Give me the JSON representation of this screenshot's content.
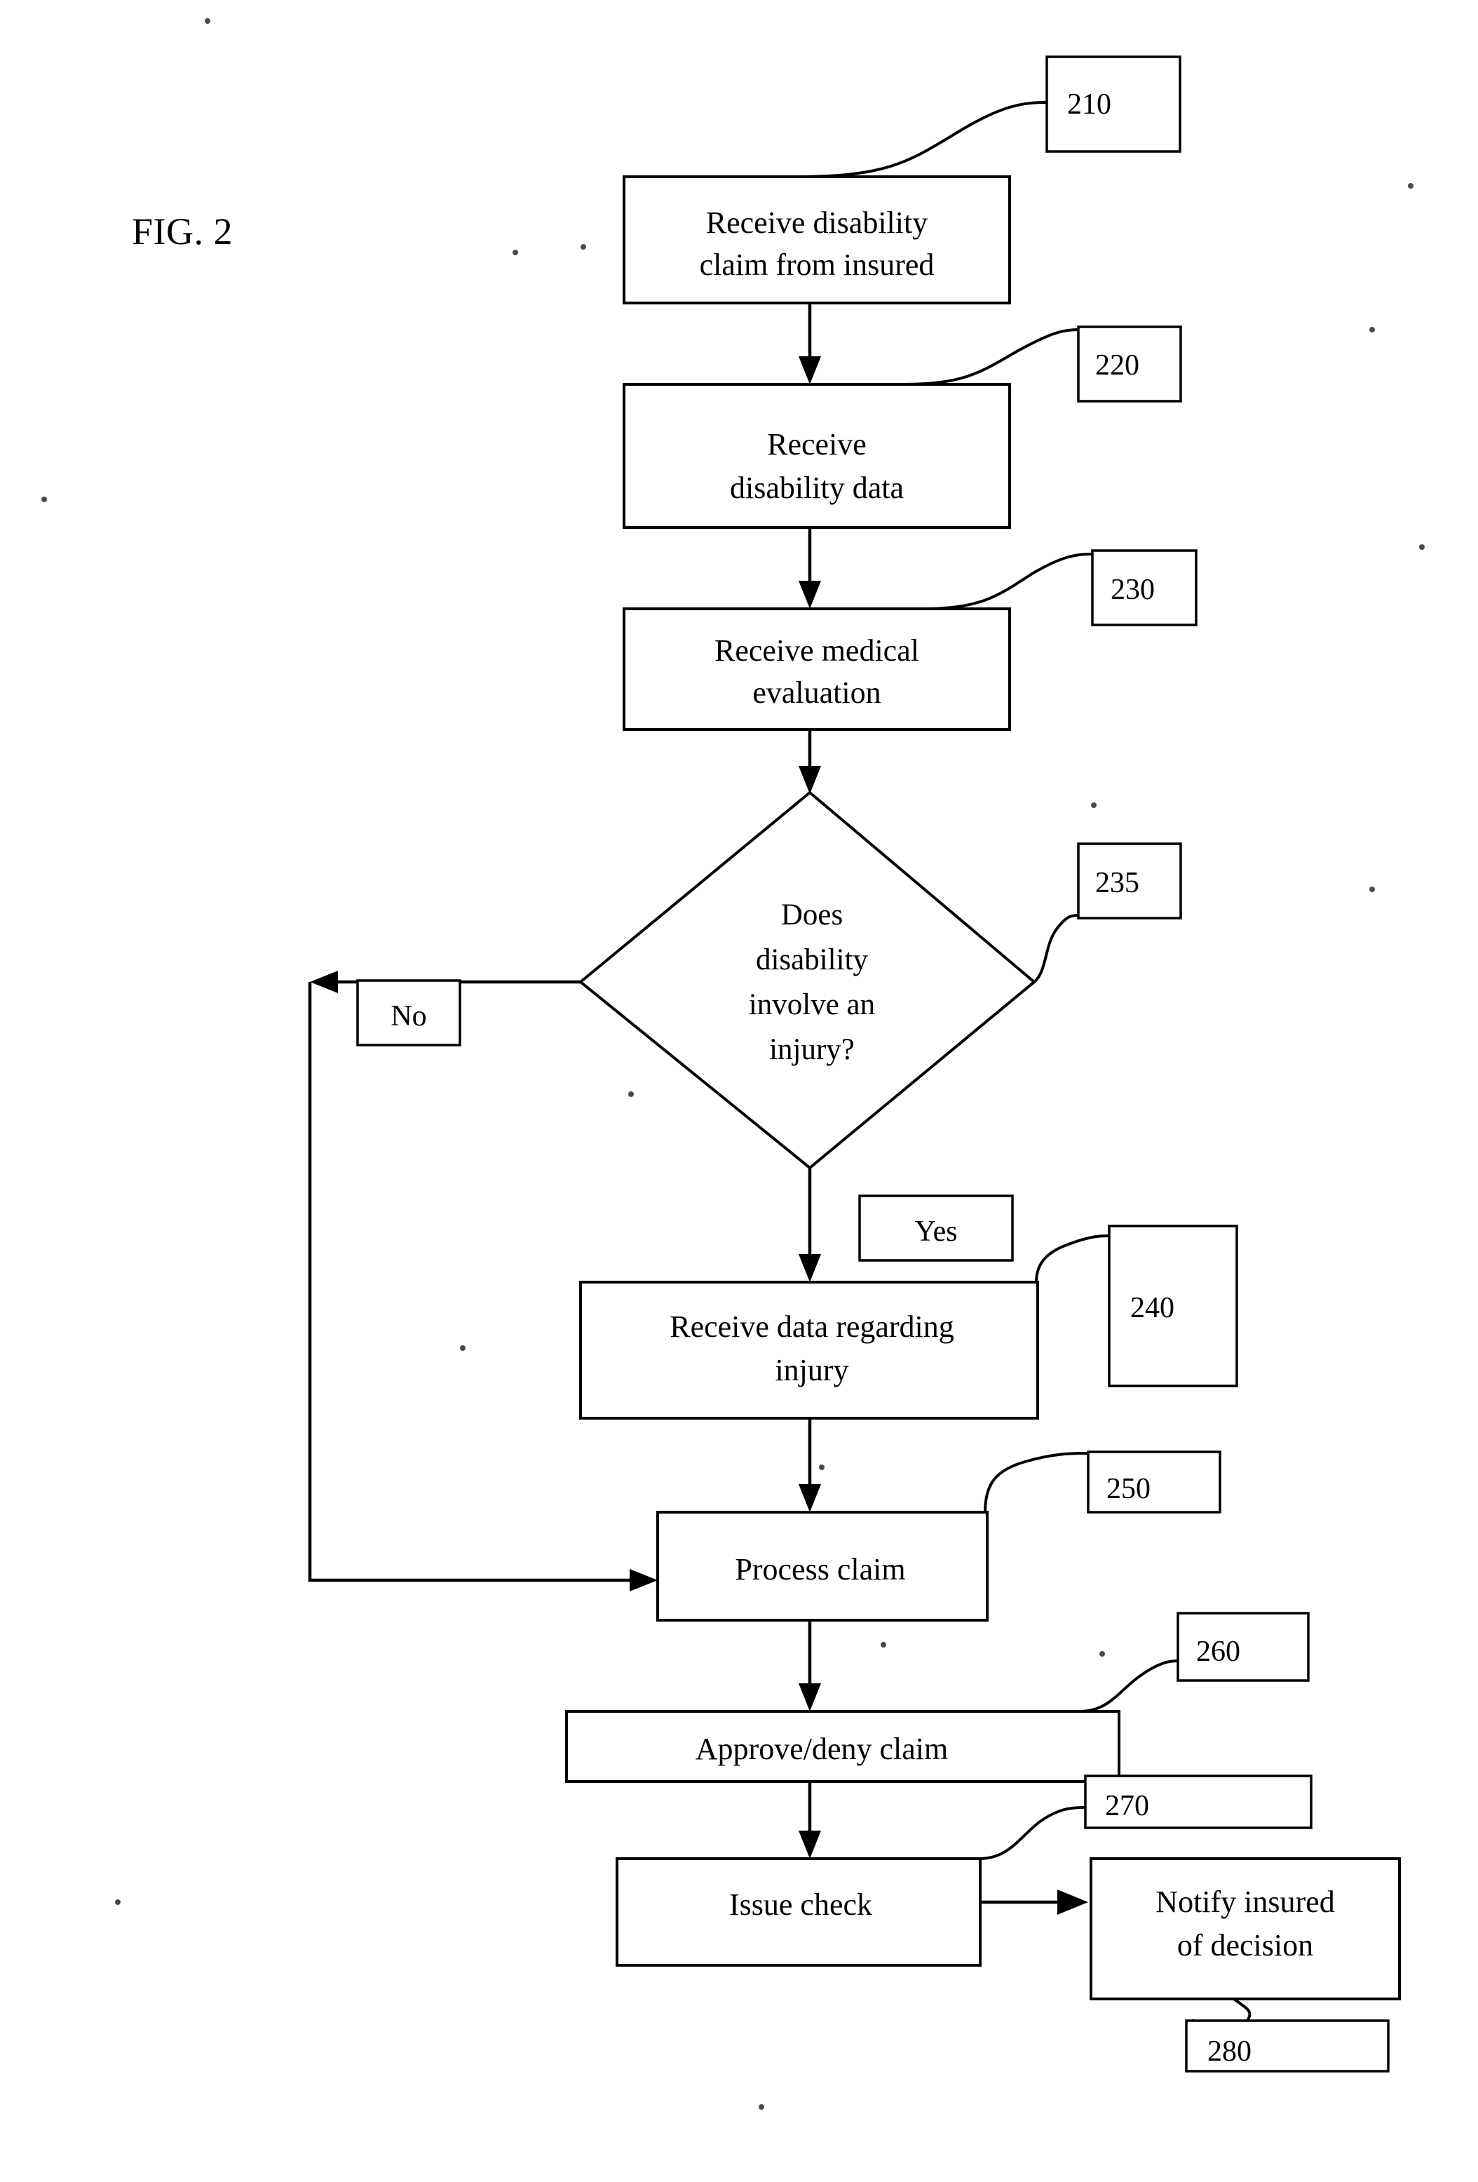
{
  "figure": {
    "title": "FIG. 2"
  },
  "nodes": [
    {
      "id": "node-210",
      "ref": "210",
      "lines": [
        "Receive disability",
        "claim from insured"
      ],
      "shape": "rect"
    },
    {
      "id": "node-220",
      "ref": "220",
      "lines": [
        "Receive",
        "disability data"
      ],
      "shape": "rect"
    },
    {
      "id": "node-230",
      "ref": "230",
      "lines": [
        "Receive medical",
        "evaluation"
      ],
      "shape": "rect"
    },
    {
      "id": "node-235",
      "ref": "235",
      "lines": [
        "Does",
        "disability",
        "involve an",
        "injury?"
      ],
      "shape": "diamond"
    },
    {
      "id": "node-240",
      "ref": "240",
      "lines": [
        "Receive data regarding",
        "injury"
      ],
      "shape": "rect"
    },
    {
      "id": "node-250",
      "ref": "250",
      "lines": [
        "Process claim"
      ],
      "shape": "rect"
    },
    {
      "id": "node-260",
      "ref": "260",
      "lines": [
        "Approve/deny claim"
      ],
      "shape": "rect"
    },
    {
      "id": "node-270",
      "ref": "270",
      "lines": [
        "Issue check"
      ],
      "shape": "rect"
    },
    {
      "id": "node-280",
      "ref": "280",
      "lines": [
        "Notify insured",
        "of decision"
      ],
      "shape": "rect"
    }
  ],
  "branches": {
    "no_label": "No",
    "yes_label": "Yes"
  },
  "refs": {
    "r210": "210",
    "r220": "220",
    "r230": "230",
    "r235": "235",
    "r240": "240",
    "r250": "250",
    "r260": "260",
    "r270": "270",
    "r280": "280"
  },
  "text": {
    "t210_l1": "Receive disability",
    "t210_l2": "claim from insured",
    "t220_l1": "Receive",
    "t220_l2": "disability data",
    "t230_l1": "Receive medical",
    "t230_l2": "evaluation",
    "t235_l1": "Does",
    "t235_l2": "disability",
    "t235_l3": "involve an",
    "t235_l4": "injury?",
    "t240_l1": "Receive data regarding",
    "t240_l2": "injury",
    "t250_l1": "Process claim",
    "t260_l1": "Approve/deny claim",
    "t270_l1": "Issue check",
    "t280_l1": "Notify insured",
    "t280_l2": "of decision"
  },
  "colors": {
    "ink": "#000000",
    "paper": "#ffffff"
  }
}
